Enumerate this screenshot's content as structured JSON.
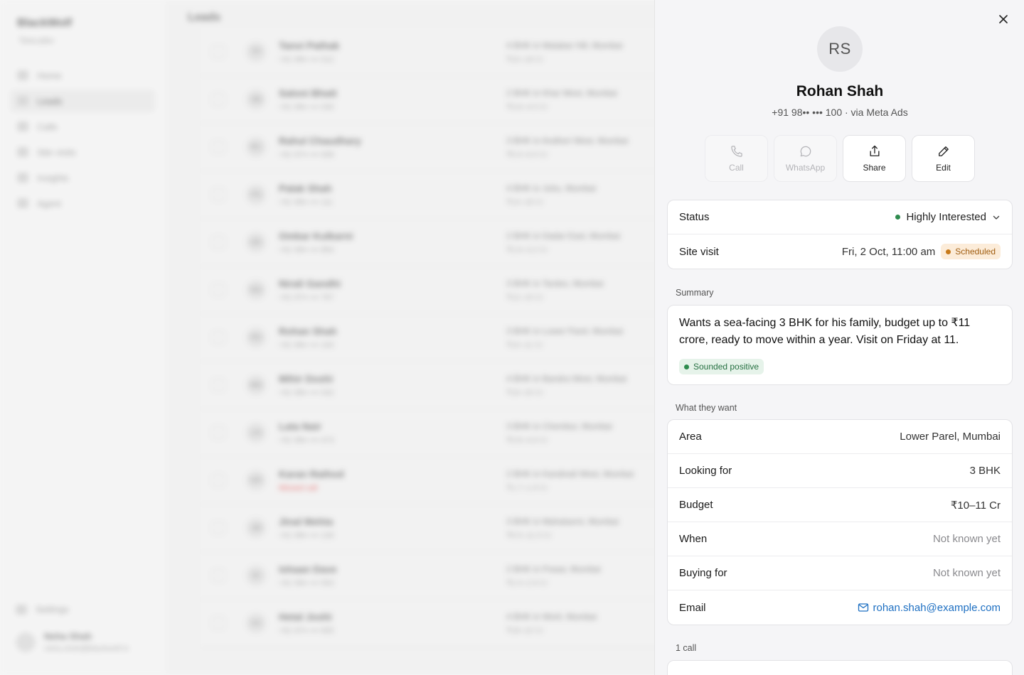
{
  "background": {
    "brand": "BlackWolf",
    "brand_sub": "Telecaller",
    "nav": [
      "Home",
      "Leads",
      "Calls",
      "Site visits",
      "Insights",
      "Agent"
    ],
    "nav_active_index": 1,
    "settings": "Settings",
    "user_name": "Neha Shah",
    "user_email": "neha.shah@blackwolf.in",
    "page_title": "Leads",
    "rows": [
      {
        "initials": "TP",
        "name": "Tanvi Pathak",
        "phone": "+91 98•• ••• 012",
        "want": "4 BHK in Malabar Hill, Mumbai",
        "budget": "₹10–18 Cr",
        "missed": false
      },
      {
        "initials": "SB",
        "name": "Saloni Bhatt",
        "phone": "+91 98•• ••• 030",
        "want": "2 BHK in Khar West, Mumbai",
        "budget": "₹3.8–4.5 Cr",
        "missed": false
      },
      {
        "initials": "RC",
        "name": "Rahul Chaudhary",
        "phone": "+91 97•• ••• 008",
        "want": "3 BHK in Andheri West, Mumbai",
        "budget": "₹5.5–6.5 Cr",
        "missed": false
      },
      {
        "initials": "PS",
        "name": "Palak Shah",
        "phone": "+91 98•• ••• 111",
        "want": "4 BHK in Juhu, Mumbai",
        "budget": "₹14–18 Cr",
        "missed": false
      },
      {
        "initials": "OK",
        "name": "Omkar Kulkarni",
        "phone": "+91 99•• ••• 864",
        "want": "2 BHK in Dadar East, Mumbai",
        "budget": "₹2.6–3.2 Cr",
        "missed": false
      },
      {
        "initials": "NG",
        "name": "Nirali Gandhi",
        "phone": "+91 97•• ••• 767",
        "want": "3 BHK in Tardeo, Mumbai",
        "budget": "₹12–15 Cr",
        "missed": false
      },
      {
        "initials": "RS",
        "name": "Rohan Shah",
        "phone": "+91 98•• ••• 100",
        "want": "3 BHK in Lower Parel, Mumbai",
        "budget": "₹10–11 Cr",
        "missed": false
      },
      {
        "initials": "MD",
        "name": "Mihir Doshi",
        "phone": "+91 98•• ••• 042",
        "want": "4 BHK in Bandra West, Mumbai",
        "budget": "₹16–20 Cr",
        "missed": false
      },
      {
        "initials": "LN",
        "name": "Lata Nair",
        "phone": "+91 98•• ••• 473",
        "want": "3 BHK in Chembur, Mumbai",
        "budget": "₹3.8–4.6 Cr",
        "missed": false
      },
      {
        "initials": "KR",
        "name": "Karan Rathod",
        "phone": "Missed call",
        "want": "2 BHK in Kandivali West, Mumbai",
        "budget": "₹1.7–1.9 Cr",
        "missed": true
      },
      {
        "initials": "JM",
        "name": "Jinal Mehta",
        "phone": "+91 98•• ••• 149",
        "want": "3 BHK in Mahalaxmi, Mumbai",
        "budget": "₹9.5–11.5 Cr",
        "missed": false
      },
      {
        "initials": "ID",
        "name": "Ishaan Dave",
        "phone": "+91 99•• ••• 553",
        "want": "2 BHK in Powai, Mumbai",
        "budget": "₹2.4–2.9 Cr",
        "missed": false
      },
      {
        "initials": "HJ",
        "name": "Hetal Joshi",
        "phone": "+91 97•• ••• 655",
        "want": "4 BHK in Worli, Mumbai",
        "budget": "₹18–22 Cr",
        "missed": false
      }
    ]
  },
  "drawer": {
    "initials": "RS",
    "name": "Rohan Shah",
    "subtitle": "+91 98•• ••• 100 · via Meta Ads",
    "actions": {
      "call": "Call",
      "whatsapp": "WhatsApp",
      "share": "Share",
      "edit": "Edit"
    },
    "status": {
      "label": "Status",
      "value": "Highly Interested",
      "dot_color": "#2e8b4e"
    },
    "site_visit": {
      "label": "Site visit",
      "value": "Fri, 2 Oct, 11:00 am",
      "badge": "Scheduled",
      "badge_dot_color": "#c77a1b"
    },
    "summary": {
      "section_label": "Summary",
      "text": "Wants a sea-facing 3 BHK for his family, budget up to ₹11 crore, ready to move within a year. Visit on Friday at 11.",
      "badge": "Sounded positive",
      "badge_dot_color": "#2e8b4e"
    },
    "wants": {
      "section_label": "What they want",
      "area_label": "Area",
      "area_value": "Lower Parel, Mumbai",
      "looking_label": "Looking for",
      "looking_value": "3 BHK",
      "budget_label": "Budget",
      "budget_value": "₹10–11 Cr",
      "when_label": "When",
      "when_value": "Not known yet",
      "buying_label": "Buying for",
      "buying_value": "Not known yet",
      "email_label": "Email",
      "email_value": "rohan.shah@example.com"
    },
    "calls_label": "1 call"
  },
  "colors": {
    "accent_link": "#1d6fc2",
    "positive": "#2e8b4e",
    "scheduled": "#c77a1b"
  }
}
